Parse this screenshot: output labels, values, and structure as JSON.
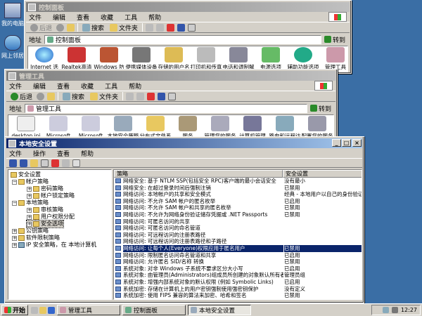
{
  "desktop": {
    "icons": [
      {
        "label": "我的电脑"
      },
      {
        "label": "网上邻居"
      }
    ]
  },
  "win1": {
    "title": "控制面板",
    "menu": [
      "文件",
      "编辑",
      "查看",
      "收藏",
      "工具",
      "帮助"
    ],
    "toolbar": {
      "back": "后退",
      "search": "搜索",
      "folders": "文件夹"
    },
    "address": {
      "label": "地址",
      "value": "控制面板",
      "go": "转到"
    },
    "icons": [
      "Internet 选项",
      "Realtek高清晰音频配置",
      "Windows 防火墙",
      "便携媒体设备",
      "存储的用户名和密码",
      "打印机和传真",
      "电话和调制解调器选项",
      "电源选项",
      "辅助功能选项",
      "管理工具"
    ]
  },
  "win2": {
    "title": "管理工具",
    "menu": [
      "文件",
      "编辑",
      "查看",
      "收藏",
      "工具",
      "帮助"
    ],
    "toolbar": {
      "back": "后退",
      "search": "搜索",
      "folders": "文件夹"
    },
    "address": {
      "label": "地址",
      "value": "管理工具",
      "go": "转到"
    },
    "icons": [
      "desktop.ini",
      "Microsoft .NET F...",
      "Microsoft .NET F...",
      "本地安全策略",
      "分布式文件系统",
      "服务",
      "管理您的服务器",
      "计算机管理",
      "路由和远程访问",
      "配置您的服务器向导"
    ]
  },
  "win3": {
    "title": "本地安全设置",
    "menu": [
      "文件",
      "操作",
      "查看",
      "帮助"
    ],
    "tree": [
      "安全设置",
      "帐户策略",
      "密码策略",
      "帐户锁定策略",
      "本地策略",
      "审核策略",
      "用户权限分配",
      "安全选项",
      "公钥策略",
      "软件限制策略",
      "IP 安全策略，在 本地计算机"
    ],
    "columns": {
      "policy": "策略",
      "setting": "安全设置"
    },
    "rows": [
      {
        "p": "网络安全: 基于 NTLM SSP(包括安全 RPC)客户端的最小会话安全",
        "s": "没有最小"
      },
      {
        "p": "网络安全: 在超过登录时间后强制注销",
        "s": "已禁用"
      },
      {
        "p": "网络访问: 本地帐户的共享和安全模式",
        "s": "经典 - 本地用户以自己的身份验证"
      },
      {
        "p": "网络访问: 不允许 SAM 帐户的匿名枚举",
        "s": "已启用"
      },
      {
        "p": "网络访问: 不允许 SAM 帐户和共享的匿名枚举",
        "s": "已禁用"
      },
      {
        "p": "网络访问: 不允许为网络身份验证储存凭据或 .NET Passports",
        "s": "已禁用"
      },
      {
        "p": "网络访问: 可匿名访问的共享",
        "s": ""
      },
      {
        "p": "网络访问: 可匿名访问的命名管道",
        "s": ""
      },
      {
        "p": "网络访问: 可远程访问的注册表路径",
        "s": ""
      },
      {
        "p": "网络访问: 可远程访问的注册表路径和子路径",
        "s": ""
      },
      {
        "p": "网络访问: 让每个人(Everyone)权限应用于匿名用户",
        "s": "已禁用"
      },
      {
        "p": "网络访问: 限制匿名访问命名管道和共享",
        "s": "已启用"
      },
      {
        "p": "网络访问: 允许匿名 SID/名称 转换",
        "s": "已禁用"
      },
      {
        "p": "系统对象: 对非 Windows 子系统不要求区分大小写",
        "s": "已启用"
      },
      {
        "p": "系统对象: 由管理员(Administrators)组成员所创建的对象默认所有者",
        "s": "管理员组"
      },
      {
        "p": "系统对象: 增强内部系统对象的默认权限 (例如 Symbolic Links)",
        "s": "已启用"
      },
      {
        "p": "系统加密: 存储在计算机上的用户密钥强制使用强密钥保护",
        "s": "没有定义"
      },
      {
        "p": "系统加密: 使用 FIPS 兼容的算法来加密、哈希和签名",
        "s": "已禁用"
      },
      {
        "p": "系统设置: 可选子系统",
        "s": "Posix"
      }
    ],
    "selected_row": 10
  },
  "taskbar": {
    "start": "开始",
    "tasks": [
      "管理工具",
      "控制面板",
      "本地安全设置"
    ],
    "active": 2,
    "clock": "12:27"
  }
}
